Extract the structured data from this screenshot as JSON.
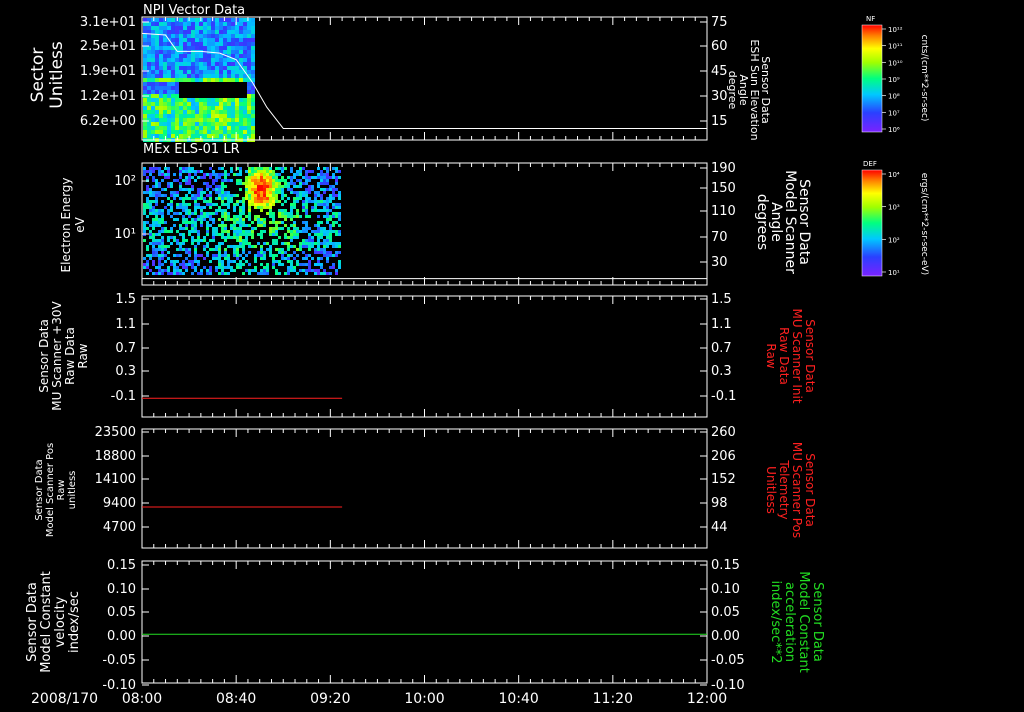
{
  "date_label": "2008/170",
  "x_ticks": [
    "08:00",
    "08:40",
    "09:20",
    "10:00",
    "10:40",
    "11:20",
    "12:00"
  ],
  "colors": {
    "white": "#ffffff",
    "red": "#ff2020",
    "green": "#22dd22"
  },
  "chart_data": [
    {
      "type": "heatmap",
      "title": "NPI Vector Data",
      "ylabel_left": [
        "Sector",
        "Unitless"
      ],
      "yticks_left": [
        "3.1e+01",
        "2.5e+01",
        "1.9e+01",
        "1.2e+01",
        "6.2e+00"
      ],
      "ylabel_right": [
        "Sensor Data",
        "ESH Sun Elevation",
        "Angle",
        "degree"
      ],
      "yticks_right": [
        "75",
        "60",
        "45",
        "30",
        "15"
      ],
      "ylim_right": [
        0,
        75
      ],
      "line_series": {
        "x": [
          "08:00",
          "08:10",
          "08:15",
          "08:25",
          "08:33",
          "08:40",
          "08:47",
          "08:53",
          "09:00",
          "12:00"
        ],
        "y": [
          65,
          64,
          54,
          54,
          53,
          49,
          35,
          20,
          7,
          7
        ]
      },
      "colorbar": {
        "tag": "NF",
        "label": "cnts/(cm**2-sr-sec)",
        "ticks": [
          "10¹²",
          "10¹¹",
          "10¹⁰",
          "10⁹",
          "10⁸",
          "10⁷",
          "10⁶"
        ]
      }
    },
    {
      "type": "heatmap",
      "title": "MEx ELS-01 LR",
      "ylabel_left": [
        "Electron Energy",
        "eV"
      ],
      "yticks_left": [
        "10²",
        "10¹"
      ],
      "ylabel_right": [
        "Sensor Data",
        "Model Scanner",
        "Angle",
        "degrees"
      ],
      "yticks_right": [
        "190",
        "150",
        "110",
        "70",
        "30"
      ],
      "ylim_right": [
        0,
        190
      ],
      "line_series": {
        "x": [
          "08:00",
          "12:00"
        ],
        "y": [
          10,
          10
        ]
      },
      "colorbar": {
        "tag": "DEF",
        "label": "ergs/(cm**2-sr-sec-eV)",
        "ticks": [
          "10⁴",
          "10³",
          "10²",
          "10¹"
        ]
      }
    },
    {
      "type": "line",
      "ylabel_left": [
        "Sensor Data",
        "MU Scanner +30V",
        "Raw Data",
        "Raw"
      ],
      "yticks_left": [
        "1.5",
        "1.1",
        "0.7",
        "0.3",
        "-0.1"
      ],
      "ylim": [
        -0.3,
        1.5
      ],
      "ylabel_right": [
        "Sensor Data",
        "MU Scanner Init",
        "Raw Data",
        "Raw"
      ],
      "yticks_right": [
        "1.5",
        "1.1",
        "0.7",
        "0.3",
        "-0.1"
      ],
      "series": [
        {
          "color": "#ff2020",
          "x": [
            "08:00",
            "09:25"
          ],
          "y": [
            -0.02,
            -0.02
          ]
        }
      ]
    },
    {
      "type": "line",
      "ylabel_left": [
        "Sensor Data",
        "Model Scanner Pos",
        "Raw",
        "unitless"
      ],
      "yticks_left": [
        "23500",
        "18800",
        "14100",
        "9400",
        "4700"
      ],
      "ylim": [
        0,
        23500
      ],
      "ylabel_right": [
        "Sensor Data",
        "MU Scanner Pos",
        "Telemetry",
        "Unitless"
      ],
      "yticks_right": [
        "260",
        "206",
        "152",
        "98",
        "44"
      ],
      "series": [
        {
          "color": "#ff2020",
          "x": [
            "08:00",
            "09:25"
          ],
          "y": [
            8100,
            8100
          ]
        }
      ]
    },
    {
      "type": "line",
      "ylabel_left": [
        "Sensor Data",
        "Model Constant",
        "velocity",
        "index/sec"
      ],
      "yticks_left": [
        "0.15",
        "0.10",
        "0.05",
        "0.00",
        "-0.05",
        "-0.10"
      ],
      "ylim": [
        -0.1,
        0.15
      ],
      "ylabel_right": [
        "Sensor Data",
        "Model Constant",
        "acceleration",
        "index/sec**2"
      ],
      "yticks_right": [
        "0.15",
        "0.10",
        "0.05",
        "0.00",
        "-0.05",
        "-0.10"
      ],
      "series": [
        {
          "color": "#22dd22",
          "x": [
            "08:00",
            "12:00"
          ],
          "y": [
            0.0,
            0.0
          ]
        }
      ]
    }
  ]
}
